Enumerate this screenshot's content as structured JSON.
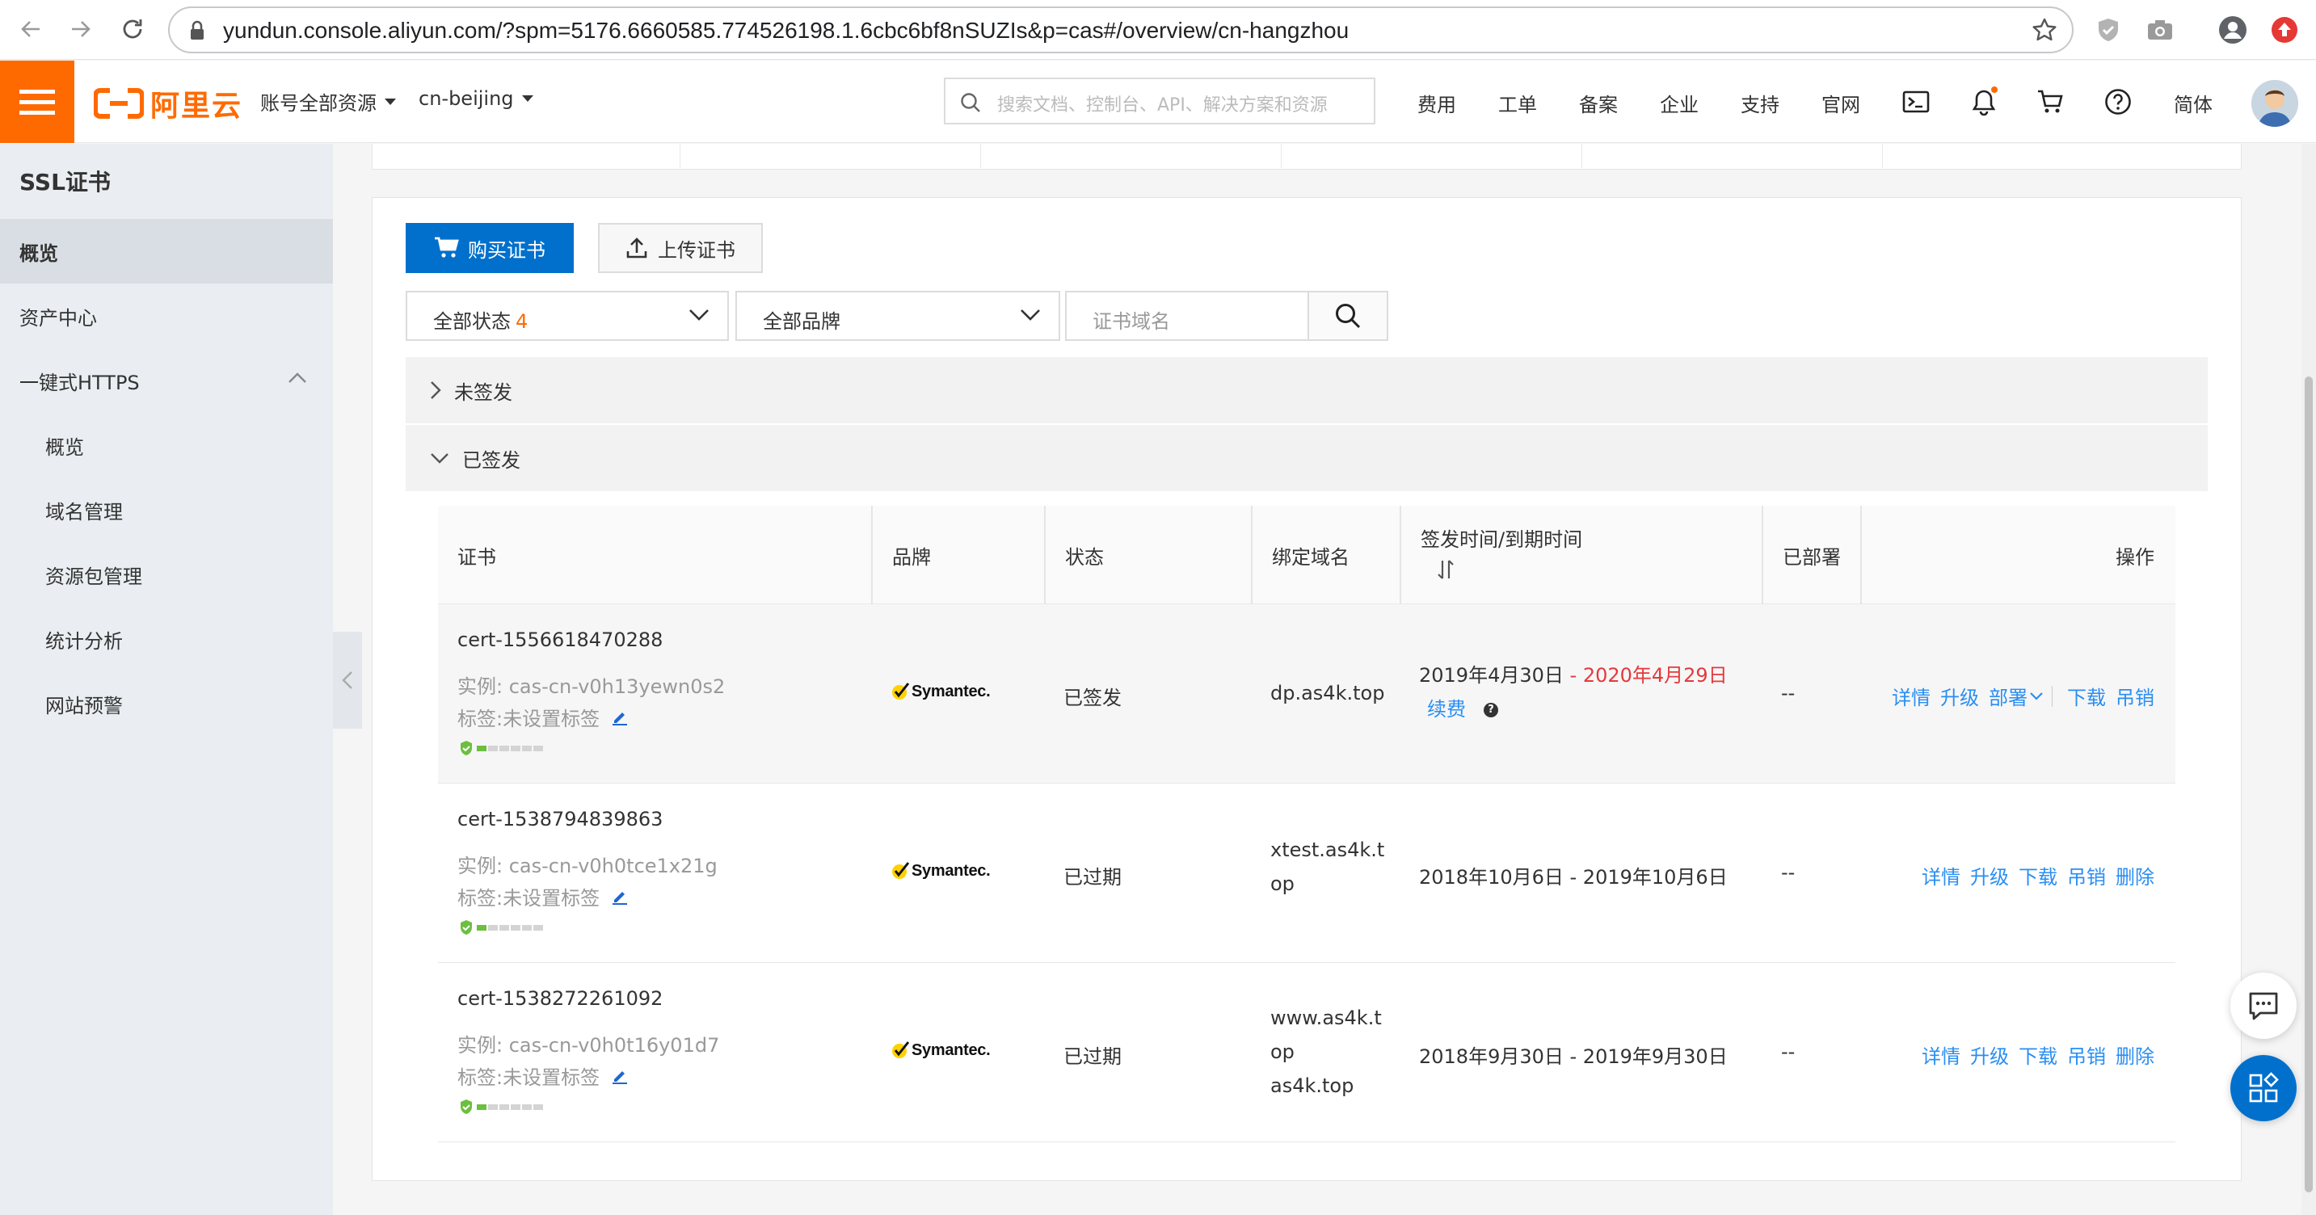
{
  "browser": {
    "url": "yundun.console.aliyun.com/?spm=5176.6660585.774526198.1.6cbc6bf8nSUZIs&p=cas#/overview/cn-hangzhou"
  },
  "topbar": {
    "logo_text": "阿里云",
    "account_scope": "账号全部资源",
    "region": "cn-beijing",
    "search_placeholder": "搜索文档、控制台、API、解决方案和资源",
    "links": [
      "费用",
      "工单",
      "备案",
      "企业",
      "支持",
      "官网"
    ],
    "language": "简体",
    "brand_color": "#ff6a00"
  },
  "sidebar": {
    "title": "SSL证书",
    "items": [
      {
        "label": "概览",
        "active": true
      },
      {
        "label": "资产中心"
      },
      {
        "label": "一键式HTTPS"
      },
      {
        "label": "概览"
      },
      {
        "label": "域名管理"
      },
      {
        "label": "资源包管理"
      },
      {
        "label": "统计分析"
      },
      {
        "label": "网站预警"
      }
    ]
  },
  "toolbar": {
    "buy_label": "购买证书",
    "upload_label": "上传证书",
    "status_filter": "全部状态",
    "status_count": "4",
    "brand_filter": "全部品牌",
    "domain_placeholder": "证书域名"
  },
  "groups": {
    "unissued": "未签发",
    "issued": "已签发"
  },
  "table": {
    "headers": {
      "cert": "证书",
      "brand": "品牌",
      "status": "状态",
      "domain": "绑定域名",
      "dates": "签发时间/到期时间",
      "deployed": "已部署",
      "actions": "操作"
    },
    "rows": [
      {
        "name": "cert-1556618470288",
        "instance": "实例: cas-cn-v0h13yewn0s2",
        "tag": "标签:未设置标签",
        "brand": "Symantec.",
        "status": "已签发",
        "domain_lines": [
          "dp.as4k.top"
        ],
        "issued": "2019年4月30日",
        "dash": " - ",
        "expires": "2020年4月29日",
        "renew": "续费",
        "deployed": "--",
        "actions": [
          "详情",
          "升级",
          "部署",
          "下载",
          "吊销"
        ]
      },
      {
        "name": "cert-1538794839863",
        "instance": "实例: cas-cn-v0h0tce1x21g",
        "tag": "标签:未设置标签",
        "brand": "Symantec.",
        "status": "已过期",
        "domain_lines": [
          "xtest.as4k.t",
          "op"
        ],
        "dates": "2018年10月6日 - 2019年10月6日",
        "deployed": "--",
        "actions": [
          "详情",
          "升级",
          "下载",
          "吊销",
          "删除"
        ]
      },
      {
        "name": "cert-1538272261092",
        "instance": "实例: cas-cn-v0h0t16y01d7",
        "tag": "标签:未设置标签",
        "brand": "Symantec.",
        "status": "已过期",
        "domain_lines": [
          "www.as4k.t",
          "op",
          "as4k.top"
        ],
        "dates": "2018年9月30日 - 2019年9月30日",
        "deployed": "--",
        "actions": [
          "详情",
          "升级",
          "下载",
          "吊销",
          "删除"
        ]
      }
    ]
  },
  "colors": {
    "link": "#2a8ef2",
    "primary": "#0070cc",
    "expire": "#e4393c"
  }
}
